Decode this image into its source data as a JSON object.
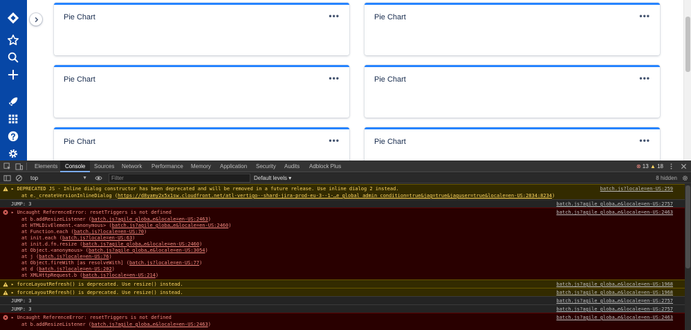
{
  "gadgets": [
    {
      "title": "Pie Chart",
      "menu": "•••"
    },
    {
      "title": "Pie Chart",
      "menu": "•••"
    },
    {
      "title": "Pie Chart",
      "menu": "•••"
    },
    {
      "title": "Pie Chart",
      "menu": "•••"
    },
    {
      "title": "Pie Chart",
      "menu": "•••"
    },
    {
      "title": "Pie Chart",
      "menu": "•••"
    }
  ],
  "sidebar": {
    "icons": [
      "jira-logo-icon",
      "star-icon",
      "search-icon",
      "plus-icon",
      "rocket-icon",
      "apps-grid-icon",
      "help-icon",
      "gear-icon"
    ],
    "color": "#0747a6"
  },
  "devtools": {
    "tabs": [
      "Elements",
      "Console",
      "Sources",
      "Network",
      "Performance",
      "Memory",
      "Application",
      "Security",
      "Audits",
      "Adblock Plus"
    ],
    "active_tab": "Console",
    "error_count": "13",
    "warning_count": "18",
    "context": "top",
    "filter_placeholder": "Filter",
    "levels": "Default levels ▾",
    "hidden": "8 hidden"
  },
  "console": {
    "m1": {
      "text": "DEPRECATED JS - Inline dialog constructor has been deprecated and will be removed in a future release. Use inline dialog 2 instead.",
      "at": "at e._createVersionInlineDialog (",
      "at_link": "https://d8yamy2x5x1sw.cloudfront.net/atl-vertigo--shard-jira-prod-eu-3--1-…e global admin condition=true&jag=true&jaguser=true&locale=en-US:2834:8234",
      "at_end": ")",
      "src": "batch.js?locale=en-US:259"
    },
    "m2": {
      "text": "JUMP: 3",
      "src": "batch.js?agile globa…e&locale=en-US:2757"
    },
    "m3": {
      "text": "Uncaught ReferenceError: resetTriggers is not defined",
      "src": "batch.js?agile globa…e&locale=en-US:2463",
      "stack": [
        {
          "pre": "at b.addResizeListener (",
          "link": "batch.js?agile globa…e&locale=en-US:2463",
          "post": ")"
        },
        {
          "pre": "at HTMLDivElement.<anonymous> (",
          "link": "batch.js?agile globa…e&locale=en-US:2460",
          "post": ")"
        },
        {
          "pre": "at Function.each (",
          "link": "batch.js?locale=en-US:70",
          "post": ")"
        },
        {
          "pre": "at init.each (",
          "link": "batch.js?locale=en-US:63",
          "post": ")"
        },
        {
          "pre": "at init.d.fn.resize (",
          "link": "batch.js?agile globa…e&locale=en-US:2460",
          "post": ")"
        },
        {
          "pre": "at Object.<anonymous> (",
          "link": "batch.js?agile globa…e&locale=en-US:3054",
          "post": ")"
        },
        {
          "pre": "at j (",
          "link": "batch.js?locale=en-US:76",
          "post": ")"
        },
        {
          "pre": "at Object.fireWith [as resolveWith] (",
          "link": "batch.js?locale=en-US:77",
          "post": ")"
        },
        {
          "pre": "at d (",
          "link": "batch.js?locale=en-US:202",
          "post": ")"
        },
        {
          "pre": "at XMLHttpRequest.b (",
          "link": "batch.js?locale=en-US:214",
          "post": ")"
        }
      ]
    },
    "m4": {
      "text": "forceLayoutRefresh() is deprecated. Use resize() instead.",
      "src": "batch.js?agile globa…e&locale=en-US:1968"
    },
    "m5": {
      "text": "forceLayoutRefresh() is deprecated. Use resize() instead.",
      "src": "batch.js?agile globa…e&locale=en-US:1968"
    },
    "m6": {
      "text": "JUMP: 3",
      "src": "batch.js?agile globa…e&locale=en-US:2757"
    },
    "m7": {
      "text": "JUMP: 3",
      "src": "batch.js?agile globa…e&locale=en-US:2757"
    },
    "m8": {
      "text": "Uncaught ReferenceError: resetTriggers is not defined",
      "src": "batch.js?agile globa…e&locale=en-US:2463",
      "stack_pre": "at b.addResizeListener (",
      "stack_link": "batch.js?agile globa…e&locale=en-US:2463",
      "stack_post": ")"
    }
  }
}
